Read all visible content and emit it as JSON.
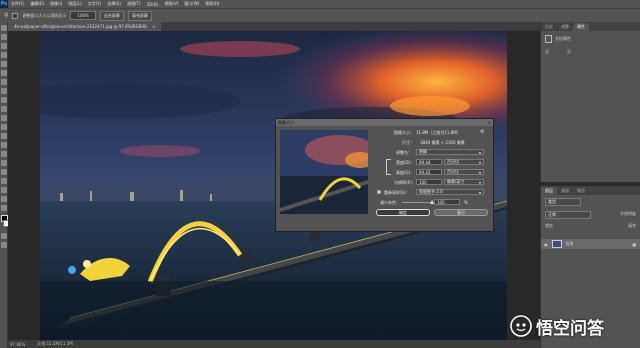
{
  "menubar": {
    "logo": "Ps",
    "items": [
      "文件(F)",
      "编辑(E)",
      "图像(I)",
      "图层(L)",
      "文字(Y)",
      "选择(S)",
      "滤镜(T)",
      "3D(D)",
      "视图(V)",
      "窗口(W)",
      "帮助(H)"
    ]
  },
  "options": {
    "checkbox_label": "调整窗口大小以满屏显示",
    "zoom_value": "100%",
    "fit_screen": "适合屏幕",
    "fill_screen": "填充屏幕"
  },
  "document": {
    "tab_title": "4k-wallpaper-afterglow-architecture-2162471.jpg @ 97.8%(RGB/8)",
    "close": "×"
  },
  "status": {
    "zoom": "97.86%",
    "doc": "文档:11.5M/11.5M"
  },
  "right_panel": {
    "top_tabs": [
      "历史",
      "调整",
      "属性"
    ],
    "doc_label": "文档属性",
    "w_label": "宽",
    "h_label": "高",
    "layer_tabs": [
      "图层",
      "通道",
      "路径"
    ],
    "kind_label": "类型",
    "blend_mode": "正常",
    "opacity_label": "不透明度",
    "lock_label": "锁定",
    "fill_label": "填充",
    "layer_name": "背景"
  },
  "dialog": {
    "title": "图像大小",
    "image_size_label": "图像大小：",
    "image_size_value": "11.8M（之前为11.8M）",
    "dimensions_label": "尺寸：",
    "dimensions_value": "3840 像素 × 2160 像素",
    "fit_label": "调整为：",
    "fit_value": "原稿",
    "width_label": "宽度(D)：",
    "width_value": "69.44",
    "width_unit": "百分比",
    "height_label": "高度(G)：",
    "height_value": "69.42",
    "height_unit": "百分比",
    "res_label": "分辨率(R)：",
    "res_value": "100",
    "res_unit": "像素/英寸",
    "resample_label": "重新采样(S)：",
    "resample_value": "保留细节 2.0",
    "reduce_label": "减少杂色：",
    "reduce_value": "100",
    "reduce_unit": "%",
    "ok": "确定",
    "cancel": "复位"
  },
  "watermark": {
    "text": "悟空问答"
  },
  "colors": {
    "ps_blue": "#31a8ff",
    "bridge_yellow": "#f2d43a",
    "sunset_orange": "#f08a2c"
  }
}
